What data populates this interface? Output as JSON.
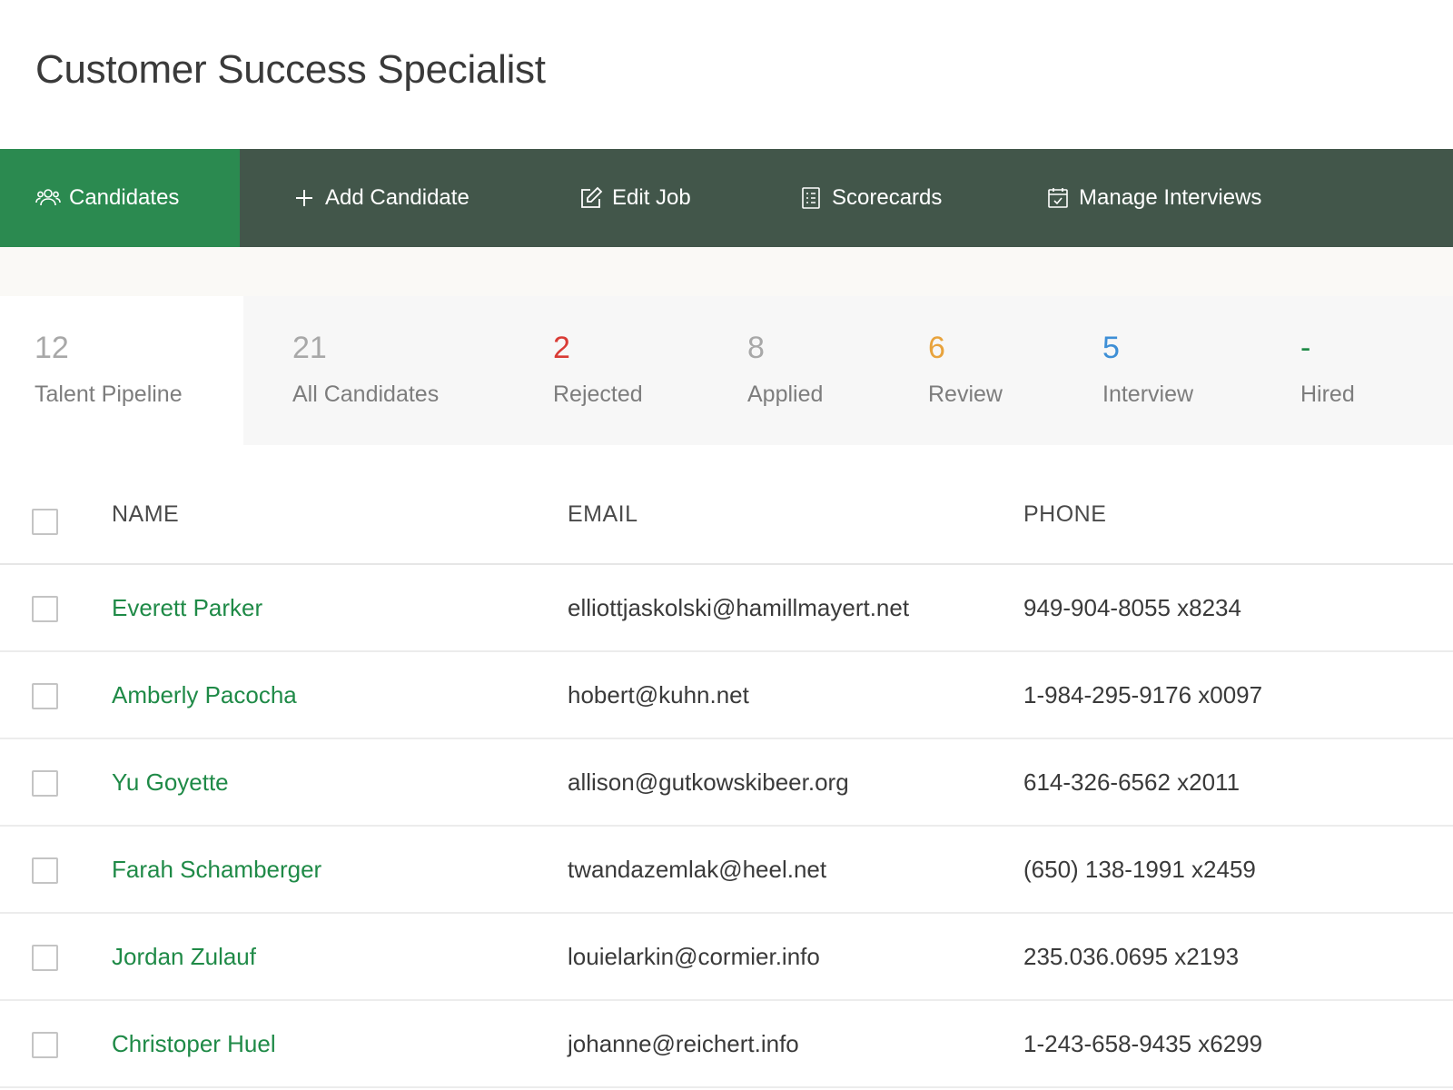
{
  "job": {
    "title": "Customer Success Specialist"
  },
  "nav": {
    "candidates": "Candidates",
    "add_candidate": "Add Candidate",
    "edit_job": "Edit Job",
    "scorecards": "Scorecards",
    "manage_interviews": "Manage Interviews"
  },
  "stats": [
    {
      "count": "12",
      "label": "Talent Pipeline",
      "color": "#a8a8a8"
    },
    {
      "count": "21",
      "label": "All Candidates",
      "color": "#a8a8a8"
    },
    {
      "count": "2",
      "label": "Rejected",
      "color": "#d93b35"
    },
    {
      "count": "8",
      "label": "Applied",
      "color": "#a8a8a8"
    },
    {
      "count": "6",
      "label": "Review",
      "color": "#e8a33d"
    },
    {
      "count": "5",
      "label": "Interview",
      "color": "#3e8fd6"
    },
    {
      "count": "-",
      "label": "Hired",
      "color": "#1f8a47"
    }
  ],
  "table": {
    "headers": {
      "name": "NAME",
      "email": "EMAIL",
      "phone": "PHONE"
    },
    "rows": [
      {
        "name": "Everett Parker",
        "email": "elliottjaskolski@hamillmayert.net",
        "phone": "949-904-8055 x8234"
      },
      {
        "name": "Amberly Pacocha",
        "email": "hobert@kuhn.net",
        "phone": "1-984-295-9176 x0097"
      },
      {
        "name": "Yu Goyette",
        "email": "allison@gutkowskibeer.org",
        "phone": "614-326-6562 x2011"
      },
      {
        "name": "Farah Schamberger",
        "email": "twandazemlak@heel.net",
        "phone": "(650) 138-1991 x2459"
      },
      {
        "name": "Jordan Zulauf",
        "email": "louielarkin@cormier.info",
        "phone": "235.036.0695 x2193"
      },
      {
        "name": "Christoper Huel",
        "email": "johanne@reichert.info",
        "phone": "1-243-658-9435 x6299"
      }
    ]
  }
}
